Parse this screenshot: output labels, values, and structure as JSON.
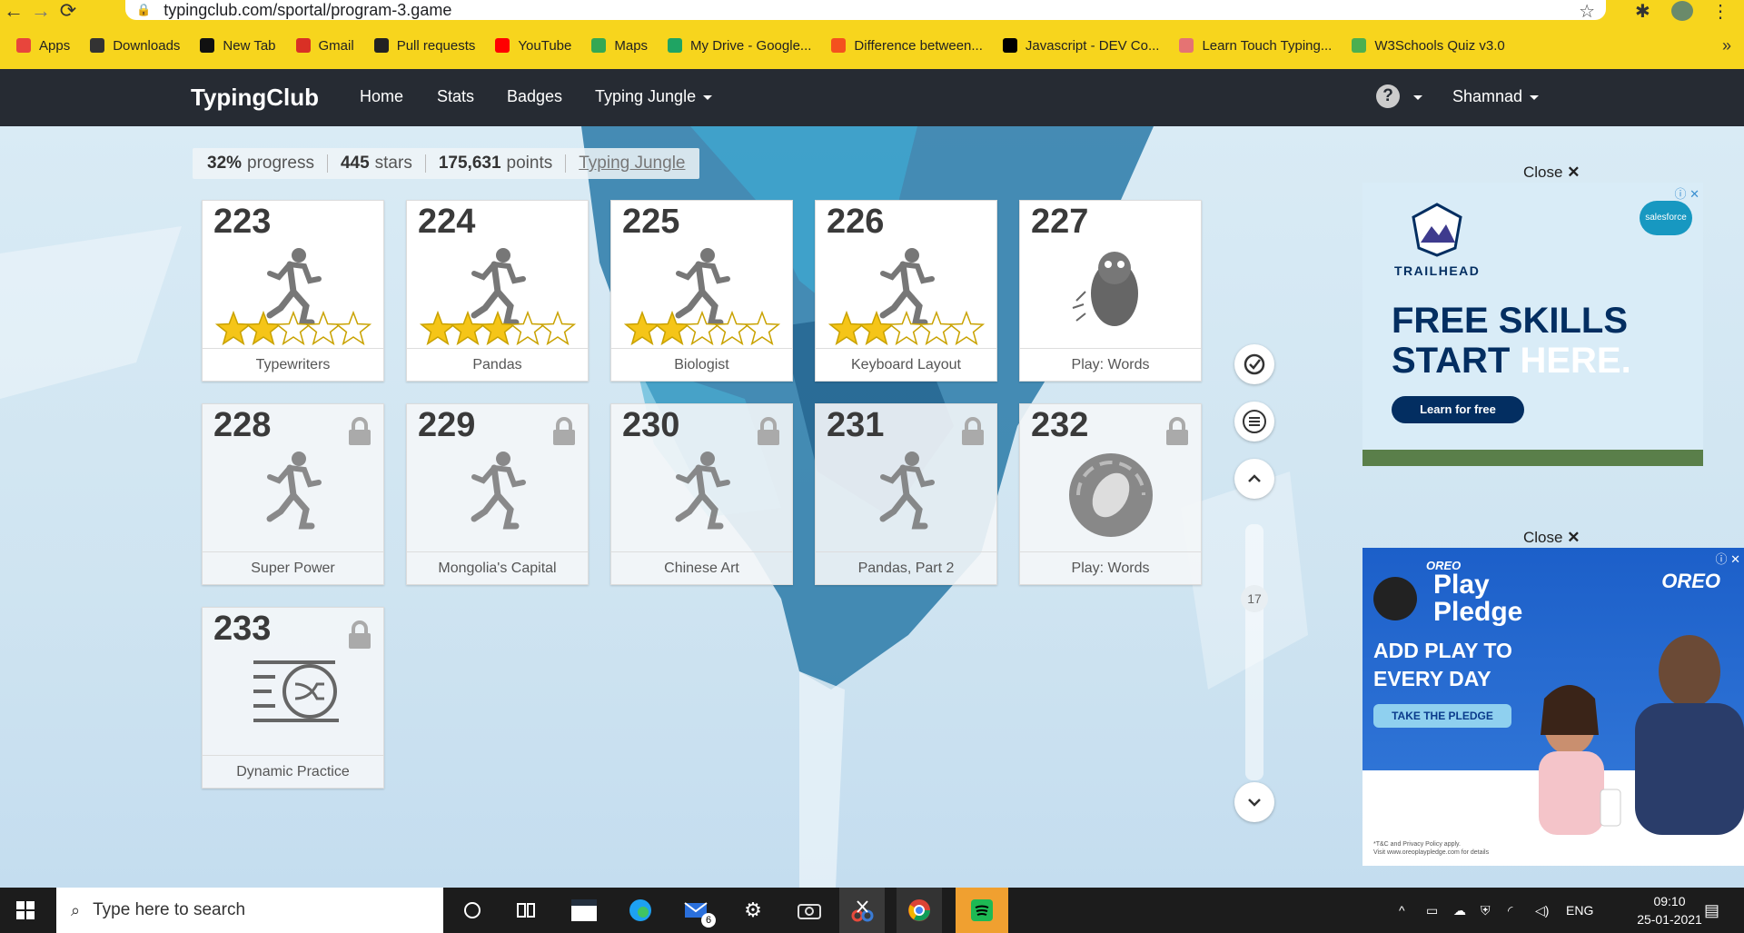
{
  "browser": {
    "url": "typingclub.com/sportal/program-3.game",
    "bookmarks": [
      {
        "label": "Apps",
        "color": "#e8453c"
      },
      {
        "label": "Downloads",
        "color": "#333333"
      },
      {
        "label": "New Tab",
        "color": "#111111"
      },
      {
        "label": "Gmail",
        "color": "#d93025"
      },
      {
        "label": "Pull requests",
        "color": "#222222"
      },
      {
        "label": "YouTube",
        "color": "#ff0000"
      },
      {
        "label": "Maps",
        "color": "#34a853"
      },
      {
        "label": "My Drive - Google...",
        "color": "#1fa463"
      },
      {
        "label": "Difference between...",
        "color": "#f4511e"
      },
      {
        "label": "Javascript - DEV Co...",
        "color": "#000000"
      },
      {
        "label": "Learn Touch Typing...",
        "color": "#e57373"
      },
      {
        "label": "W3Schools Quiz v3.0",
        "color": "#4caf50"
      }
    ],
    "bookmarks_more": "»"
  },
  "nav": {
    "brand": "TypingClub",
    "home": "Home",
    "stats": "Stats",
    "badges": "Badges",
    "program": "Typing Jungle",
    "help": "?",
    "user": "Shamnad"
  },
  "progress": {
    "percent": "32%",
    "percent_label": "progress",
    "stars": "445",
    "stars_label": "stars",
    "points": "175,631",
    "points_label": "points",
    "program_link": "Typing Jungle"
  },
  "lessons": [
    {
      "num": "223",
      "label": "Typewriters",
      "stars": 2,
      "locked": false,
      "kind": "runner"
    },
    {
      "num": "224",
      "label": "Pandas",
      "stars": 3,
      "locked": false,
      "kind": "runner"
    },
    {
      "num": "225",
      "label": "Biologist",
      "stars": 2,
      "locked": false,
      "kind": "runner"
    },
    {
      "num": "226",
      "label": "Keyboard Layout",
      "stars": 2,
      "locked": false,
      "kind": "runner"
    },
    {
      "num": "227",
      "label": "Play: Words",
      "stars": 0,
      "locked": false,
      "kind": "game"
    },
    {
      "num": "228",
      "label": "Super Power",
      "stars": 0,
      "locked": true,
      "kind": "runner"
    },
    {
      "num": "229",
      "label": "Mongolia's Capital",
      "stars": 0,
      "locked": true,
      "kind": "runner"
    },
    {
      "num": "230",
      "label": "Chinese Art",
      "stars": 0,
      "locked": true,
      "kind": "runner"
    },
    {
      "num": "231",
      "label": "Pandas, Part 2",
      "stars": 0,
      "locked": true,
      "kind": "runner"
    },
    {
      "num": "232",
      "label": "Play: Words",
      "stars": 0,
      "locked": true,
      "kind": "game-locked"
    },
    {
      "num": "233",
      "label": "Dynamic Practice",
      "stars": 0,
      "locked": true,
      "kind": "practice"
    }
  ],
  "side": {
    "page_number": "17"
  },
  "ads": {
    "close_label": "Close",
    "ad1": {
      "brand": "TRAILHEAD",
      "corner": "salesforce",
      "headline1": "FREE SKILLS",
      "headline2a": "START ",
      "headline2b": "HERE.",
      "cta": "Learn for free"
    },
    "ad2": {
      "logo": "OREO",
      "title1": "Play",
      "title2": "Pledge",
      "headline1": "ADD PLAY TO",
      "headline2": "EVERY DAY",
      "cta": "TAKE THE PLEDGE",
      "fine1": "*T&C and Privacy Policy apply.",
      "fine2": "Visit www.oreoplaypledge.com for details"
    }
  },
  "taskbar": {
    "search_placeholder": "Type here to search",
    "mail_badge": "6",
    "lang": "ENG",
    "time": "09:10",
    "date": "25-01-2021"
  }
}
